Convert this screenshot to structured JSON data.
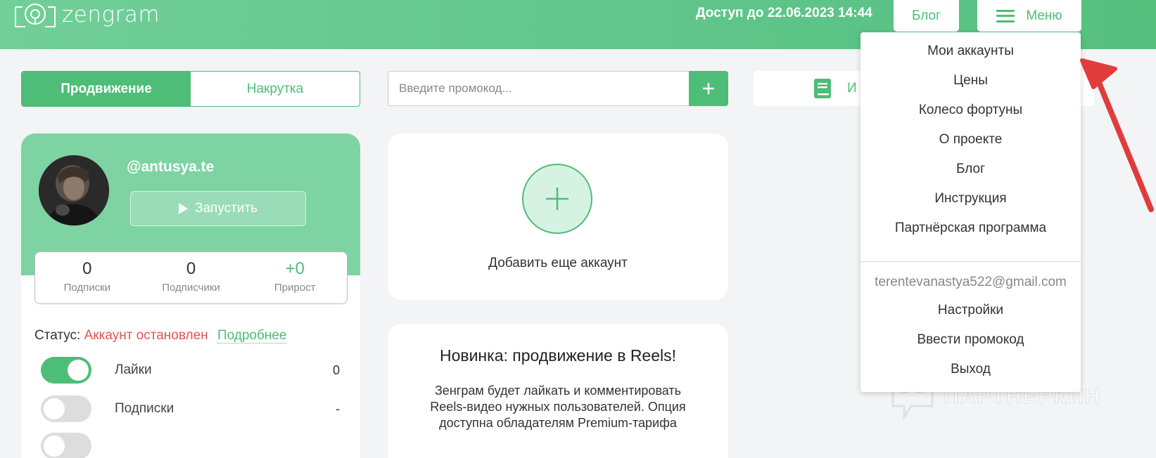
{
  "header": {
    "logo_text": "zengram",
    "access_text": "Доступ до 22.06.2023 14:44",
    "blog_label": "Блог",
    "menu_label": "Меню"
  },
  "tabs": [
    {
      "label": "Продвижение",
      "active": true
    },
    {
      "label": "Накрутка",
      "active": false
    }
  ],
  "promo": {
    "placeholder": "Введите промокод...",
    "value": ""
  },
  "instruction": {
    "label": "И"
  },
  "account": {
    "username": "@antusya.te",
    "run_label": "Запустить",
    "stats": [
      {
        "value": "0",
        "label": "Подписки"
      },
      {
        "value": "0",
        "label": "Подписчики"
      },
      {
        "value": "+0",
        "label": "Прирост"
      }
    ],
    "status_label": "Статус:",
    "status_value": "Аккаунт остановлен",
    "more_label": "Подробнее",
    "toggles": [
      {
        "label": "Лайки",
        "value": "0",
        "on": true
      },
      {
        "label": "Подписки",
        "value": "-",
        "on": false
      }
    ]
  },
  "add_account": {
    "label": "Добавить еще аккаунт"
  },
  "news": {
    "title": "Новинка: продвижение в Reels!",
    "body": "Зенграм будет лайкать и комментировать Reels-видео нужных пользователей. Опция доступна обладателям Premium-тарифа"
  },
  "menu": {
    "items": [
      "Мои аккаунты",
      "Цены",
      "Колесо фортуны",
      "О проекте",
      "Блог",
      "Инструкция",
      "Партнёрская программа"
    ],
    "email": "terentevanastya522@gmail.com",
    "account_items": [
      "Настройки",
      "Ввести промокод",
      "Выход"
    ]
  },
  "watermark": {
    "text": "ПАРТНЕРКИН"
  },
  "colors": {
    "accent": "#4dbd78",
    "header_bg": "#5fc58a",
    "card_header_bg": "#7ed3a3",
    "status_red": "#e35353",
    "annotation_arrow": "#e03c3c"
  }
}
